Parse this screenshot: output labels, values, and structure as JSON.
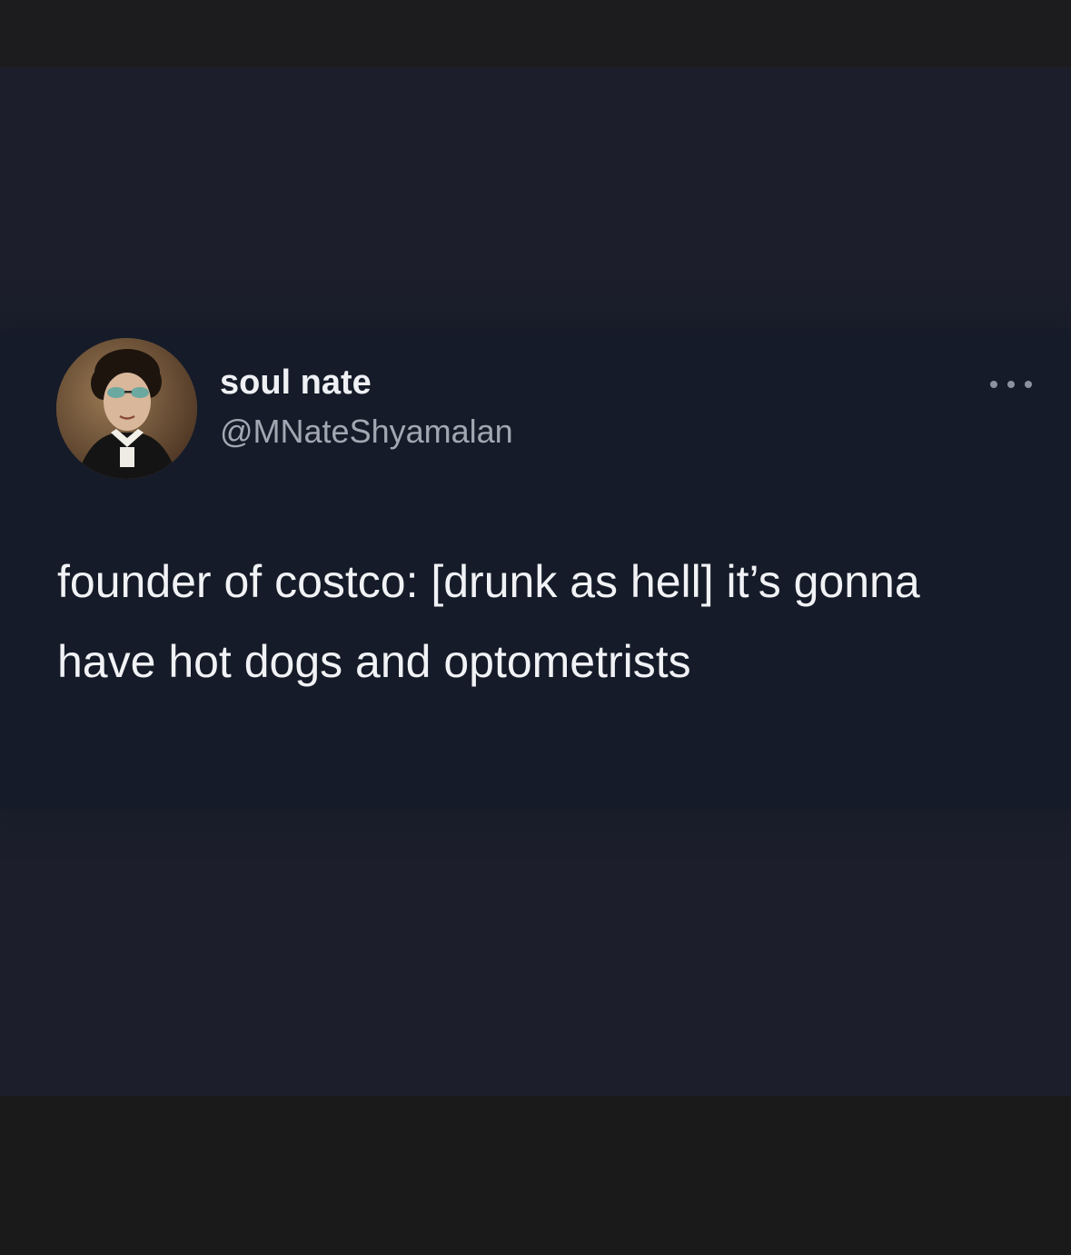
{
  "tweet": {
    "display_name": "soul nate",
    "handle": "@MNateShyamalan",
    "text": "founder of costco: [drunk as hell] it’s gonna have hot dogs and optometrists",
    "avatar_icon": "profile-avatar-painting",
    "more_icon": "more-options-icon"
  },
  "colors": {
    "background": "#1c1e2b",
    "card": "#151b28",
    "name": "#eef0f4",
    "handle": "#a2a8b2",
    "text": "#f1f2f5"
  }
}
